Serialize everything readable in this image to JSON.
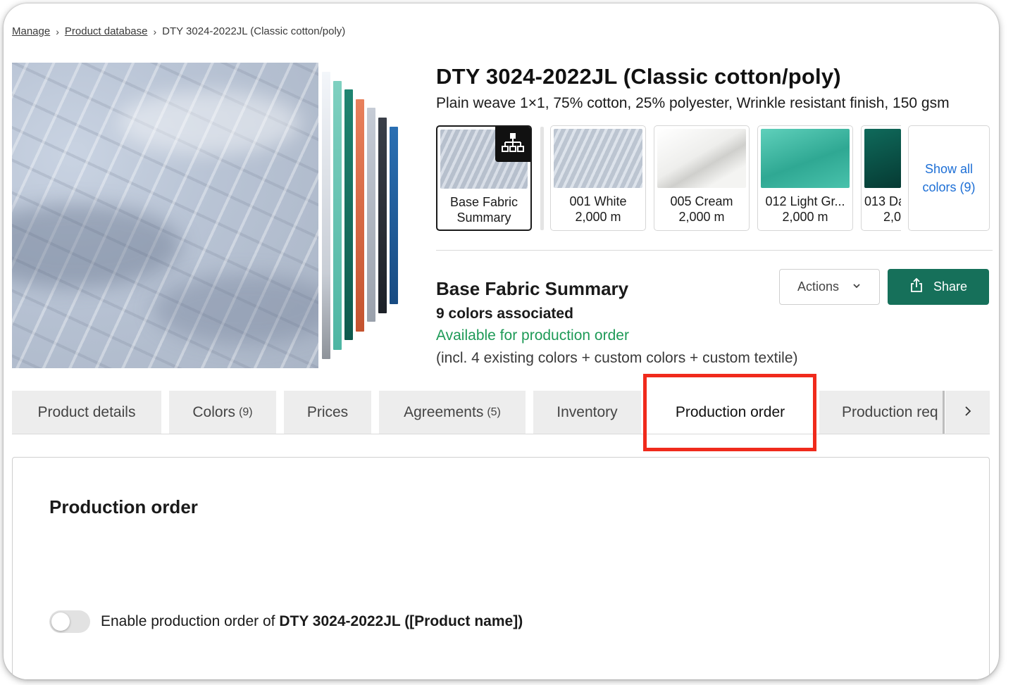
{
  "breadcrumb": {
    "items": [
      "Manage",
      "Product database"
    ],
    "current": "DTY 3024-2022JL (Classic cotton/poly)"
  },
  "product": {
    "title": "DTY 3024-2022JL (Classic cotton/poly)",
    "description": "Plain weave 1×1, 75% cotton, 25% polyester, Wrinkle resistant finish, 150 gsm"
  },
  "colors": [
    {
      "line1": "Base Fabric",
      "line2": "Summary",
      "swatch": "#c3ccda"
    },
    {
      "line1": "001 White",
      "line2": "2,000 m",
      "swatch": "#c9d1dc"
    },
    {
      "line1": "005 Cream",
      "line2": "2,000 m",
      "swatch": "#f2f2f0"
    },
    {
      "line1": "012 Light Gr...",
      "line2": "2,000 m",
      "swatch": "#3fb9a4"
    },
    {
      "line1": "013 Da",
      "line2": "2,0",
      "swatch": "#0d4d44"
    }
  ],
  "show_all": {
    "line1": "Show all",
    "line2": "colors (9)"
  },
  "summary": {
    "title": "Base Fabric Summary",
    "count": "9 colors associated",
    "availability": "Available for production order",
    "note": "(incl. 4 existing colors + custom colors + custom textile)"
  },
  "buttons": {
    "actions": "Actions",
    "share": "Share"
  },
  "tabs": [
    {
      "label": "Product details",
      "count": ""
    },
    {
      "label": "Colors",
      "count": "(9)"
    },
    {
      "label": "Prices",
      "count": ""
    },
    {
      "label": "Agreements",
      "count": "(5)"
    },
    {
      "label": "Inventory",
      "count": ""
    },
    {
      "label": "Production order",
      "count": ""
    },
    {
      "label": "Production req",
      "count": ""
    }
  ],
  "panel": {
    "title": "Production order",
    "toggle_prefix": "Enable production order of ",
    "toggle_bold": "DTY 3024-2022JL ([Product name])",
    "toggle_enabled": false
  },
  "colors_accent": {
    "primary": "#16705a",
    "available": "#1e9a57",
    "link": "#1d6fd6",
    "highlight": "#f02a1c"
  }
}
